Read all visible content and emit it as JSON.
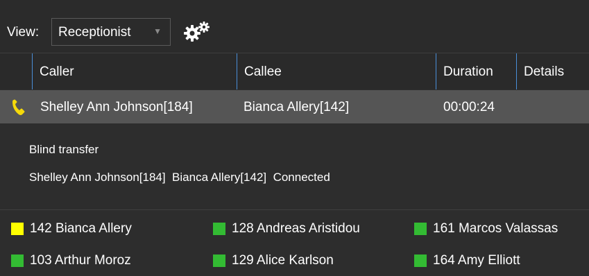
{
  "toolbar": {
    "view_label": "View:",
    "view_value": "Receptionist",
    "caret": "▼",
    "settings_icon": "gear-icon"
  },
  "columns": [
    "Caller",
    "Callee",
    "Duration",
    "Details"
  ],
  "active_call": {
    "icon": "phone-icon",
    "caller": "Shelley Ann Johnson[184]",
    "callee": "Bianca Allery[142]",
    "duration": "00:00:24",
    "details": ""
  },
  "call_details": {
    "type": "Blind transfer",
    "status_line": "Shelley Ann Johnson[184]  Bianca Allery[142]  Connected"
  },
  "extensions": [
    {
      "label": "142 Bianca Allery",
      "status_color": "#ffff00"
    },
    {
      "label": "128 Andreas Aristidou",
      "status_color": "#33bb33"
    },
    {
      "label": "161 Marcos Valassas",
      "status_color": "#33bb33"
    },
    {
      "label": "103 Arthur Moroz",
      "status_color": "#33bb33"
    },
    {
      "label": "129 Alice Karlson",
      "status_color": "#33bb33"
    },
    {
      "label": "164 Amy Elliott",
      "status_color": "#33bb33"
    }
  ],
  "colors": {
    "background": "#2d2d2d",
    "row_selected": "#555555",
    "header_border": "#4a8fd9",
    "phone_icon": "#f5d90a"
  }
}
